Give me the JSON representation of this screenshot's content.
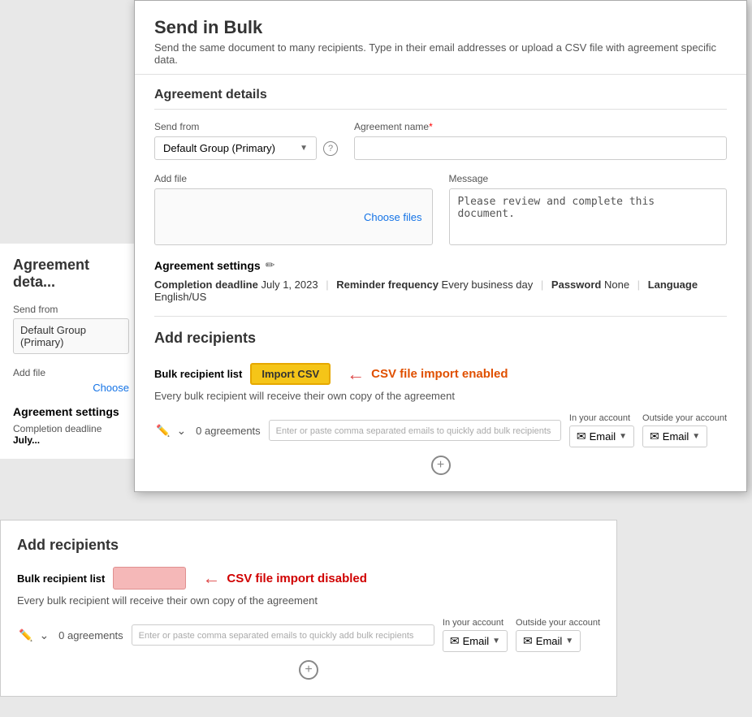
{
  "modal": {
    "title": "Send in Bulk",
    "subtitle": "Send the same document to many recipients. Type in their email addresses or upload a CSV file with agreement specific data.",
    "agreement_details_heading": "Agreement details",
    "send_from_label": "Send from",
    "send_from_value": "Default Group (Primary)",
    "agreement_name_label": "Agreement name",
    "agreement_name_required": "*",
    "agreement_name_placeholder": "",
    "add_file_label": "Add file",
    "choose_files_label": "Choose files",
    "message_label": "Message",
    "message_value": "Please review and complete this document.",
    "agreement_settings_label": "Agreement settings",
    "completion_deadline_label": "Completion deadline",
    "completion_deadline_value": "July 1, 2023",
    "reminder_freq_label": "Reminder frequency",
    "reminder_freq_value": "Every business day",
    "password_label": "Password",
    "password_value": "None",
    "language_label": "Language",
    "language_value": "English/US",
    "add_recipients_heading": "Add recipients",
    "bulk_list_label": "Bulk recipient list",
    "import_csv_btn": "Import CSV",
    "csv_enabled_annotation": "CSV file import enabled",
    "bulk_desc": "Every bulk recipient will receive their own copy of the agreement",
    "email_placeholder": "Enter or paste comma separated emails to quickly add bulk recipients",
    "in_your_account_label": "In your account",
    "outside_your_account_label": "Outside your account",
    "email_btn": "Email",
    "agreements_count": "0 agreements",
    "add_row_btn": "+"
  },
  "background": {
    "agreement_details": "Agreement deta...",
    "send_from_label": "Send from",
    "send_from_value": "Default Group (Primary)",
    "add_file_label": "Add file",
    "choose_label": "Choose",
    "agreement_settings": "Agreement settings",
    "completion_deadline": "Completion deadline",
    "deadline_val": "July..."
  },
  "bottom": {
    "add_recipients_heading": "Add recipients",
    "bulk_list_label": "Bulk recipient list",
    "csv_disabled_annotation": "CSV file import disabled",
    "bulk_desc": "Every bulk recipient will receive their own copy of the agreement",
    "email_placeholder": "Enter or paste comma separated emails to quickly add bulk recipients",
    "in_your_account_label": "In your account",
    "outside_your_account_label": "Outside your account",
    "email_btn": "Email",
    "agreements_count": "0 agreements"
  }
}
